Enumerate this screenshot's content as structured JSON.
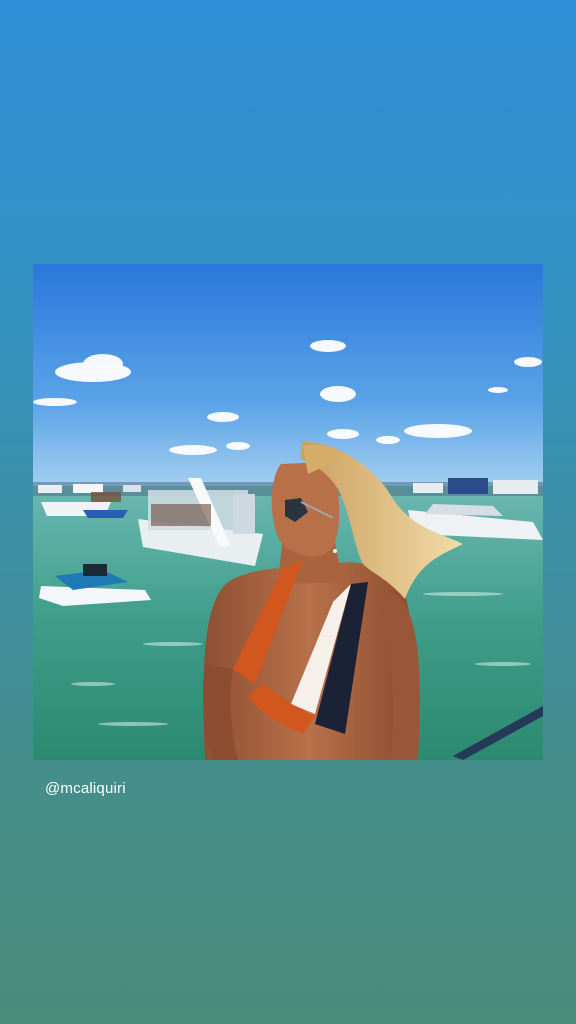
{
  "story": {
    "mention": "@mcaliquiri",
    "background_top": "#2f8fd6",
    "background_bottom": "#4b8c7a"
  },
  "photo": {
    "kind": "shared-post-image",
    "colors": {
      "sky_top": "#2f7fe0",
      "sky_bottom": "#8fc3ee",
      "water_top": "#5fb0a8",
      "water_bottom": "#2f8f78",
      "swimsuit_orange": "#d2571e",
      "swimsuit_white": "#f5f1ea",
      "swimsuit_navy": "#1c2236",
      "hair": "#e8c27a",
      "skin": "#b36a45"
    }
  }
}
